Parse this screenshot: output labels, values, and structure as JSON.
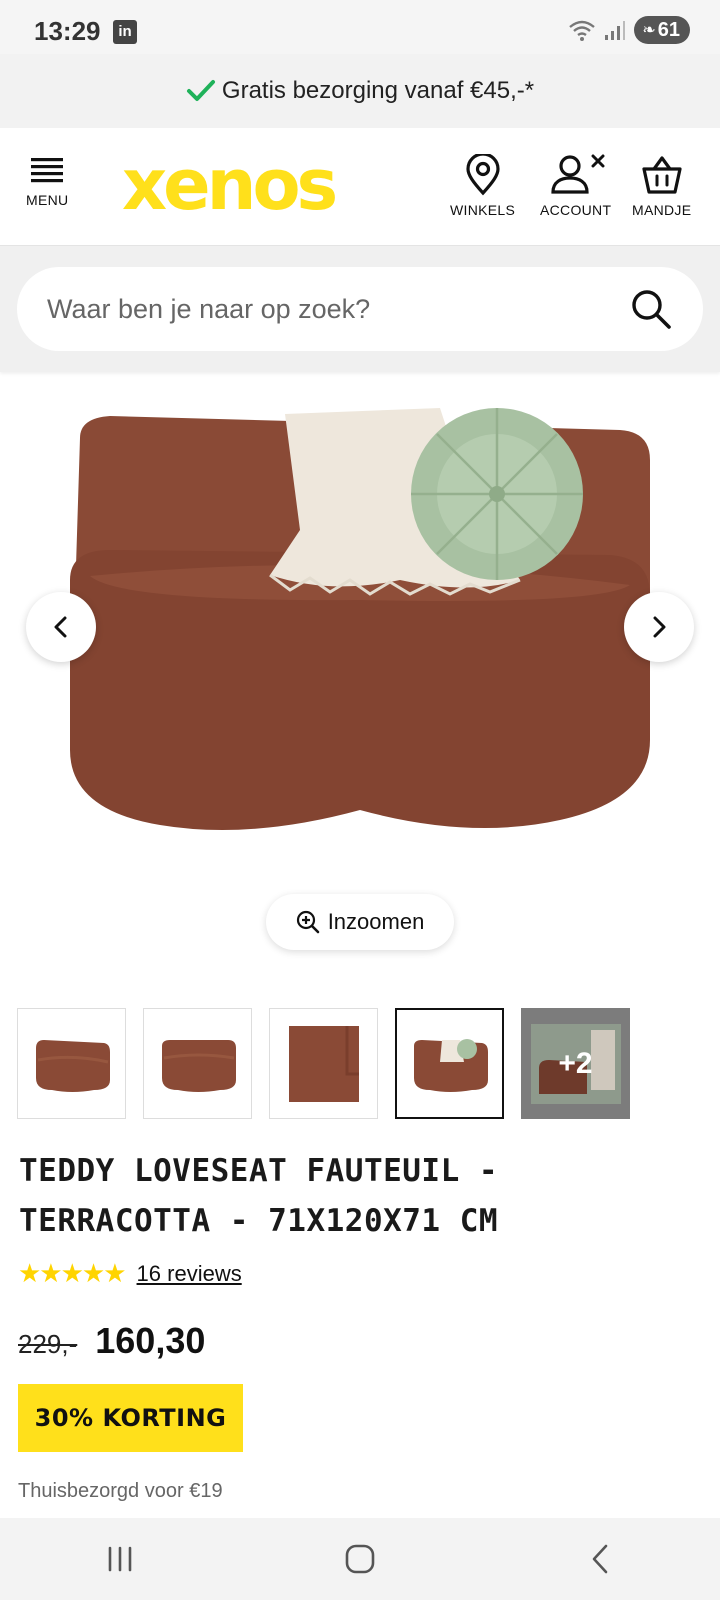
{
  "status_bar": {
    "time": "13:29",
    "linkedin_label": "in",
    "battery": "61"
  },
  "banner": {
    "text": "Gratis bezorging vanaf €45,-*"
  },
  "header": {
    "menu_label": "MENU",
    "logo_text": "xenos",
    "stores_label": "WINKELS",
    "account_label": "ACCOUNT",
    "basket_label": "MANDJE"
  },
  "search": {
    "placeholder": "Waar ben je naar op zoek?"
  },
  "gallery": {
    "zoom_label": "Inzoomen",
    "more_label": "+2",
    "thumbnail_count": 5,
    "active_thumbnail": 4
  },
  "product": {
    "title": "TEDDY LOVESEAT FAUTEUIL - TERRACOTTA - 71X120X71 CM",
    "rating_stars": 5,
    "reviews": "16 reviews",
    "old_price": "229,-",
    "new_price": "160,30",
    "discount": "30% KORTING",
    "delivery": "Thuisbezorgd voor €19"
  },
  "colors": {
    "brand_yellow": "#ffe01b",
    "sofa": "#8a4a36",
    "check_green": "#1fb25a"
  }
}
